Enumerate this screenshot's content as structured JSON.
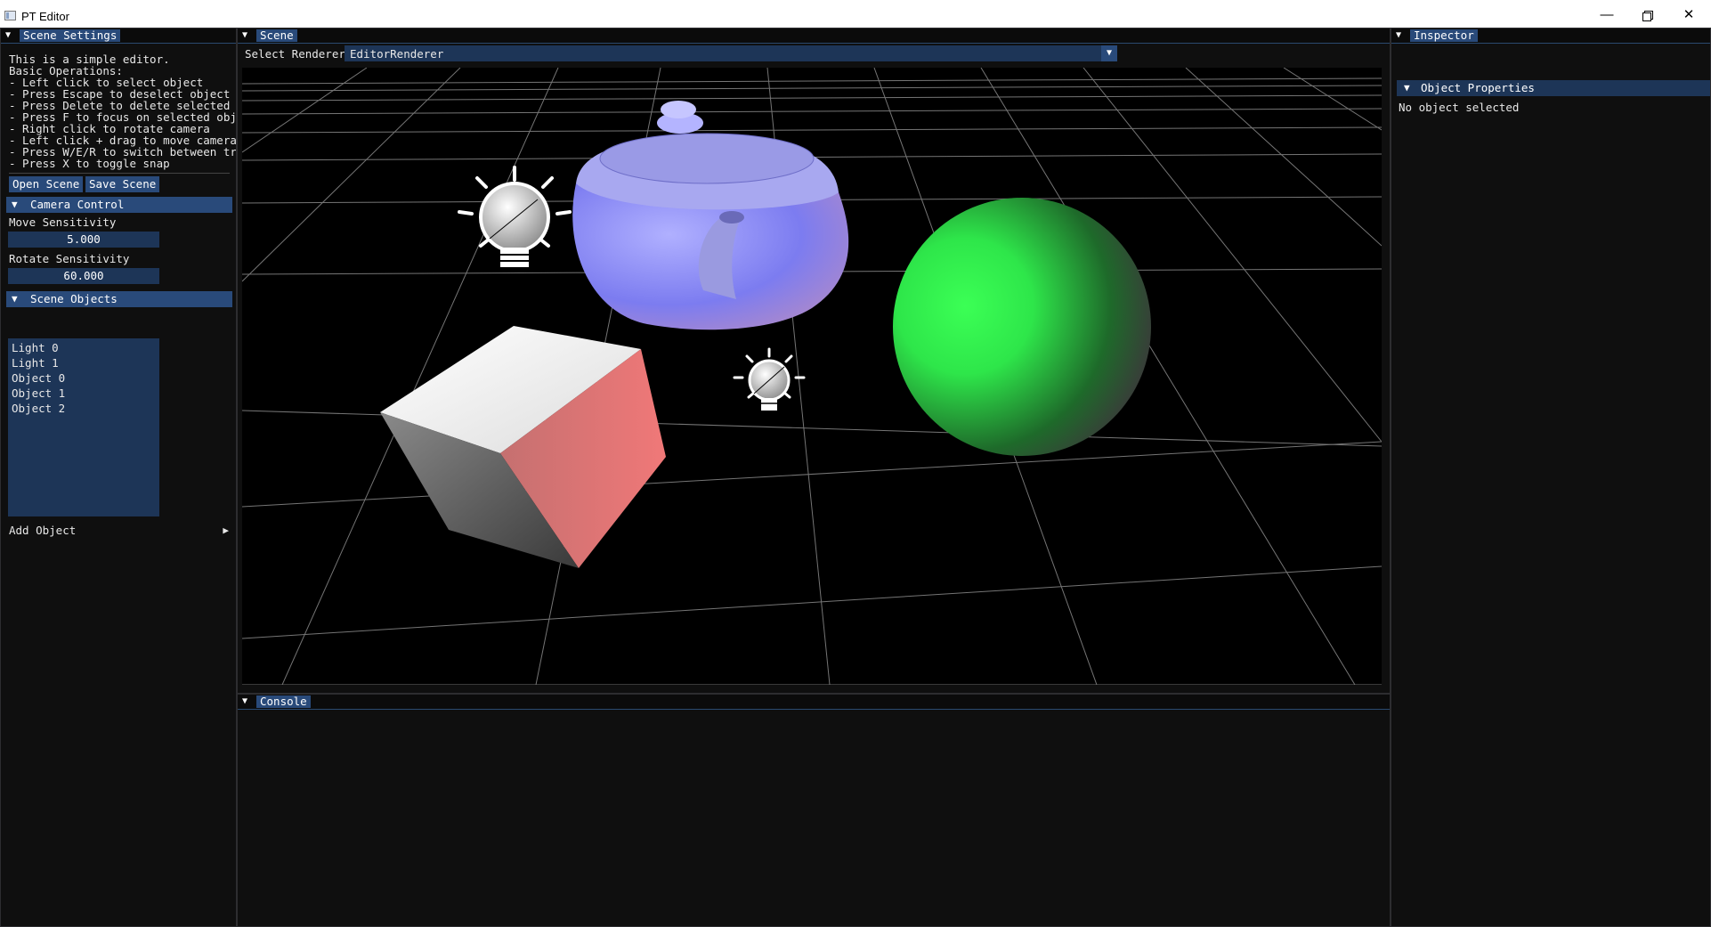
{
  "window": {
    "title": "PT Editor",
    "minimize_glyph": "—",
    "close_glyph": "✕"
  },
  "scene_settings": {
    "tab_label": "Scene Settings",
    "help_lines": [
      "This is a simple editor.",
      "Basic Operations:",
      "- Left click to select object",
      "- Press Escape to deselect object",
      "- Press Delete to delete selected ob",
      "- Press F to focus on selected objec",
      "- Right click to rotate camera",
      "- Left click + drag to move camera",
      "- Press W/E/R to switch between tran",
      "- Press X to toggle snap"
    ],
    "open_scene_label": "Open Scene",
    "save_scene_label": "Save Scene",
    "camera_control": {
      "header": "Camera Control",
      "move_label": "Move Sensitivity",
      "move_value": "5.000",
      "rotate_label": "Rotate Sensitivity",
      "rotate_value": "60.000"
    },
    "scene_objects": {
      "header": "Scene Objects",
      "items": [
        "Light 0",
        "Light 1",
        "Object 0",
        "Object 1",
        "Object 2"
      ]
    },
    "add_object_label": "Add Object"
  },
  "scene": {
    "tab_label": "Scene",
    "select_renderer_label": "Select Renderer",
    "renderer_value": "EditorRenderer"
  },
  "console": {
    "tab_label": "Console"
  },
  "inspector": {
    "tab_label": "Inspector",
    "properties_header": "Object Properties",
    "status": "No object selected"
  },
  "colors": {
    "accent": "#294a7a",
    "field_bg": "#1d3557",
    "panel_bg": "#0f0f0f",
    "sphere": "#2ee64a",
    "teapot": "#8c8cff",
    "cube_side": "#e06a6a"
  },
  "icons": [
    "light-bulb-icon",
    "collapse-triangle-icon",
    "dropdown-arrow-icon",
    "submenu-arrow-icon"
  ]
}
